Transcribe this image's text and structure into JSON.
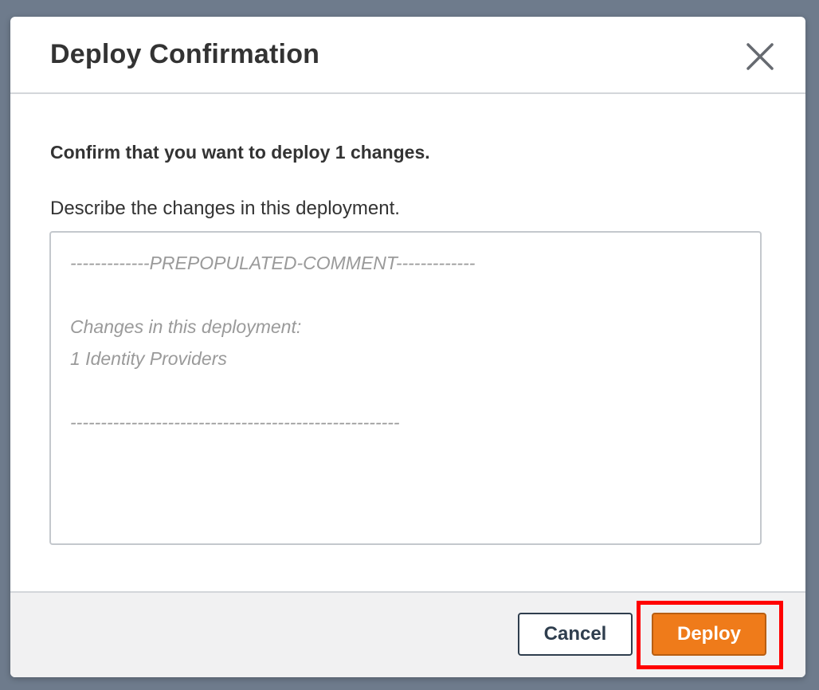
{
  "dialog": {
    "title": "Deploy Confirmation",
    "close_icon": "close-icon",
    "confirm_message": "Confirm that you want to deploy 1 changes.",
    "description_label": "Describe the changes in this deployment.",
    "comment_value": "-------------PREPOPULATED-COMMENT-------------\n\nChanges in this deployment:\n1 Identity Providers\n\n------------------------------------------------------"
  },
  "footer": {
    "cancel_label": "Cancel",
    "deploy_label": "Deploy"
  },
  "colors": {
    "deploy_button": "#ef7b1a",
    "cancel_border": "#2f3e4e",
    "highlight": "#ff0000",
    "backdrop": "#6e7b8c"
  }
}
